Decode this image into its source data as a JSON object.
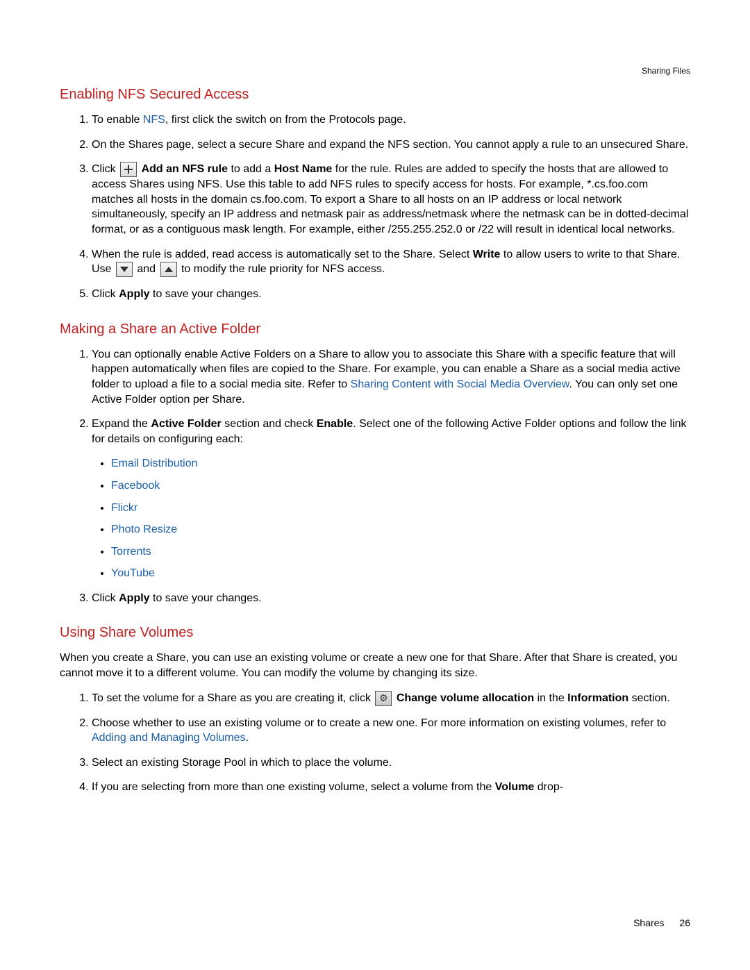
{
  "header": {
    "breadcrumb": "Sharing Files"
  },
  "section1": {
    "heading": "Enabling NFS Secured Access",
    "items": {
      "i1a": "To enable ",
      "i1link": "NFS",
      "i1b": ", first click the switch on from the Protocols page.",
      "i2": "On the Shares page, select a secure Share and expand the NFS section. You cannot apply a rule to an unsecured Share.",
      "i3a": "Click ",
      "i3b1": "Add an NFS rule",
      "i3b2": " to add a ",
      "i3b3": "Host Name",
      "i3c": " for the rule. Rules are added to specify the hosts that are allowed to access Shares using NFS. Use this table to add NFS rules to specify access for hosts. For example, *.cs.foo.com matches all hosts in the domain cs.foo.com. To export a Share to all hosts on an IP address or local network simultaneously, specify an IP address and netmask pair as address/netmask where the netmask can be in dotted-decimal format, or as a contiguous mask length. For example, either /255.255.252.0 or /22 will result in identical local networks.",
      "i4a": "When the rule is added, read access is automatically set to the Share. Select ",
      "i4b": "Write",
      "i4c": " to allow users to write to that Share. Use ",
      "i4d": " and ",
      "i4e": " to modify the rule priority for NFS access.",
      "i5a": "Click ",
      "i5b": "Apply",
      "i5c": " to save your changes."
    }
  },
  "section2": {
    "heading": "Making a Share an Active Folder",
    "items": {
      "i1a": "You can optionally enable Active Folders on a Share to allow you to associate this Share with a specific feature that will happen automatically when files are copied to the Share. For example, you can enable a Share as a social media active folder to upload a file to a social media site. Refer to ",
      "i1link": "Sharing Content with Social Media Overview",
      "i1b": ". You can only set one Active Folder option per Share.",
      "i2a": "Expand the ",
      "i2b": "Active Folder",
      "i2c": " section and check ",
      "i2d": "Enable",
      "i2e": ". Select one of the following Active Folder options and follow the link for details on configuring each:",
      "sub": {
        "a": "Email Distribution",
        "b": "Facebook",
        "c": "Flickr",
        "d": "Photo Resize",
        "e": "Torrents",
        "f": "YouTube"
      },
      "i3a": "Click ",
      "i3b": "Apply",
      "i3c": " to save your changes."
    }
  },
  "section3": {
    "heading": "Using Share Volumes",
    "para": "When you create a Share, you can use an existing volume or create a new one for that Share. After that Share is created, you cannot move it to a different volume. You can modify the volume by changing its size.",
    "items": {
      "i1a": "To set the volume for a Share as you are creating it, click ",
      "i1b": "Change volume allocation",
      "i1c": " in the ",
      "i1d": "Information",
      "i1e": " section.",
      "i2a": "Choose whether to use an existing volume or to create a new one. For more information on existing volumes, refer to ",
      "i2link": "Adding and Managing Volumes",
      "i2b": ".",
      "i3": "Select an existing Storage Pool in which to place the volume.",
      "i4a": "If you are selecting from more than one existing volume, select a volume from the ",
      "i4b": "Volume",
      "i4c": " drop-"
    }
  },
  "footer": {
    "label": "Shares",
    "page": "26"
  }
}
